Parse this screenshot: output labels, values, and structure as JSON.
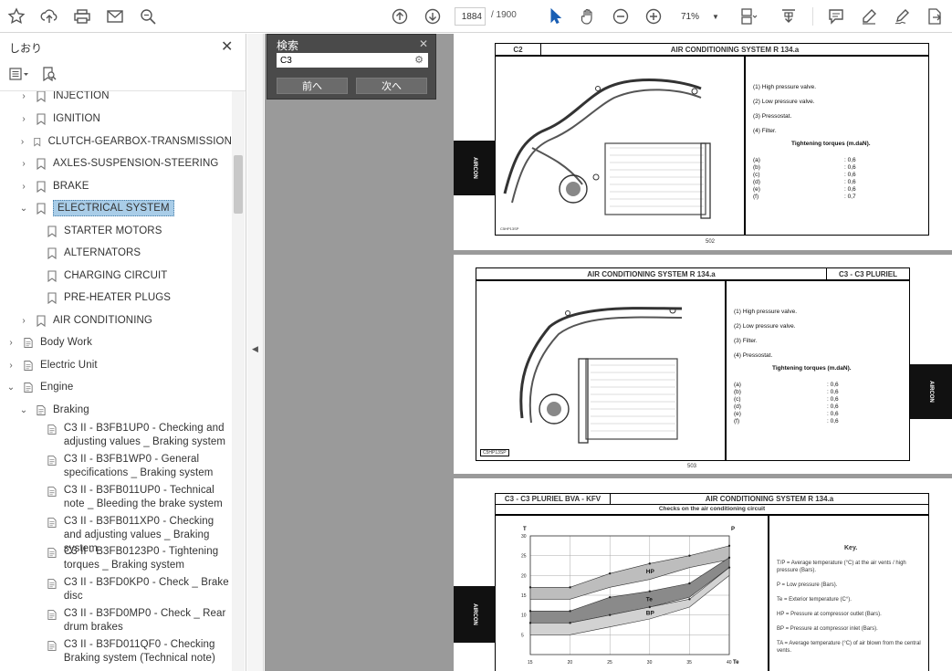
{
  "toolbar": {
    "page_current": "1884",
    "page_total": "/ 1900",
    "zoom": "71%"
  },
  "sidebar": {
    "title": "しおり",
    "items": [
      {
        "label": "INJECTION",
        "level": 1,
        "expanded": false,
        "type": "bookmark"
      },
      {
        "label": "IGNITION",
        "level": 1,
        "expanded": false,
        "type": "bookmark"
      },
      {
        "label": "CLUTCH-GEARBOX-TRANSMISSION",
        "level": 1,
        "expanded": false,
        "type": "bookmark"
      },
      {
        "label": "AXLES-SUSPENSION-STEERING",
        "level": 1,
        "expanded": false,
        "type": "bookmark"
      },
      {
        "label": "BRAKE",
        "level": 1,
        "expanded": false,
        "type": "bookmark"
      },
      {
        "label": "ELECTRICAL SYSTEM",
        "level": 1,
        "expanded": true,
        "type": "bookmark",
        "selected": true
      },
      {
        "label": "STARTER MOTORS",
        "level": 2,
        "type": "bookmark"
      },
      {
        "label": "ALTERNATORS",
        "level": 2,
        "type": "bookmark"
      },
      {
        "label": "CHARGING CIRCUIT",
        "level": 2,
        "type": "bookmark"
      },
      {
        "label": "PRE-HEATER PLUGS",
        "level": 2,
        "type": "bookmark"
      },
      {
        "label": "AIR CONDITIONING",
        "level": 1,
        "expanded": false,
        "type": "bookmark"
      },
      {
        "label": "Body Work",
        "level": 0,
        "expanded": false,
        "type": "doc"
      },
      {
        "label": "Electric Unit",
        "level": 0,
        "expanded": false,
        "type": "doc"
      },
      {
        "label": "Engine",
        "level": 0,
        "expanded": true,
        "type": "doc"
      },
      {
        "label": "Braking",
        "level": 1,
        "expanded": true,
        "type": "doc"
      },
      {
        "label": "C3 II - B3FB1UP0 - Checking and adjusting values _ Braking system",
        "level": 2,
        "type": "page"
      },
      {
        "label": "C3 II - B3FB1WP0 - General specifications _ Braking system",
        "level": 2,
        "type": "page"
      },
      {
        "label": "C3 II - B3FB011UP0 - Technical note _ Bleeding the brake system",
        "level": 2,
        "type": "page"
      },
      {
        "label": "C3 II - B3FB011XP0 - Checking and adjusting values _ Braking system",
        "level": 2,
        "type": "page"
      },
      {
        "label": "C3 II - B3FB0123P0 - Tightening torques _ Braking system",
        "level": 2,
        "type": "page"
      },
      {
        "label": "C3 II - B3FD0KP0 - Check _ Brake disc",
        "level": 2,
        "type": "page"
      },
      {
        "label": "C3 II - B3FD0MP0 - Check _ Rear drum brakes",
        "level": 2,
        "type": "page"
      },
      {
        "label": "C3 II - B3FD011QF0 - Checking Braking system (Technical note)",
        "level": 2,
        "type": "page"
      }
    ]
  },
  "find": {
    "title": "検索",
    "query": "C3",
    "prev_label": "前へ",
    "next_label": "次へ"
  },
  "pages": {
    "p1": {
      "model": "C2",
      "title": "AIR CONDITIONING SYSTEM R 134.a",
      "tab": "AIRCON",
      "legend": [
        "(1) High pressure valve.",
        "(2) Low pressure valve.",
        "(3) Pressostat.",
        "(4) Filter."
      ],
      "torque_title": "Tightening torques (m.daN).",
      "torques": [
        [
          "(a)",
          ": 0,6"
        ],
        [
          "(b)",
          ": 0,6"
        ],
        [
          "(c)",
          ": 0,6"
        ],
        [
          "(d)",
          ": 0,6"
        ],
        [
          "(e)",
          ": 0,6"
        ],
        [
          "(f)",
          ": 0,7"
        ]
      ],
      "page_no": "502"
    },
    "p2": {
      "model": "C3 - C3 PLURIEL",
      "title": "AIR CONDITIONING SYSTEM R 134.a",
      "tab": "AIRCON",
      "legend": [
        "(1) High pressure valve.",
        "(2) Low pressure valve.",
        "(3) Filter.",
        "(4) Pressostat."
      ],
      "torque_title": "Tightening torques (m.daN).",
      "torques": [
        [
          "(a)",
          ": 0,6"
        ],
        [
          "(b)",
          ": 0,6"
        ],
        [
          "(c)",
          ": 0,6"
        ],
        [
          "(d)",
          ": 0,6"
        ],
        [
          "(e)",
          ": 0,6"
        ],
        [
          "(f)",
          ": 0,6"
        ]
      ],
      "fig_code": "C5HP13SP",
      "page_no": "503"
    },
    "p3": {
      "model": "C3 - C3 PLURIEL BVA - KFV",
      "title": "AIR CONDITIONING SYSTEM R 134.a",
      "subtitle": "Checks on the air conditioning circuit",
      "tab": "AIRCON",
      "key_title": "Key.",
      "key": [
        "T/P = Average temperature (°C) at the air vents / high pressure (Bars).",
        "P = Low pressure (Bars).",
        "Te = Exterior temperature (C°).",
        "HP = Pressure at compressor outlet (Bars).",
        "BP = Pressure at compressor inlet (Bars).",
        "TA = Average temperature (°C) of air blown from the central vents."
      ]
    }
  },
  "chart_data": {
    "type": "area",
    "title": "Checks on the air conditioning circuit",
    "xlabel": "Te",
    "ylabel_left": "T",
    "ylabel_right": "P",
    "x_ticks": [
      "15",
      "20",
      "25",
      "30",
      "35",
      "40"
    ],
    "y_ticks": [
      "5",
      "10",
      "15",
      "20",
      "25",
      "30"
    ],
    "xlim": [
      15,
      40
    ],
    "ylim": [
      0,
      30
    ],
    "series": [
      {
        "name": "HP",
        "upper": [
          17,
          17,
          20.5,
          23,
          25,
          27.5
        ],
        "lower": [
          14,
          14,
          17,
          19,
          22,
          24
        ]
      },
      {
        "name": "Te",
        "upper": [
          11,
          11,
          14.5,
          16,
          18,
          24.5
        ],
        "lower": [
          8,
          8,
          10,
          12,
          14.5,
          22
        ]
      },
      {
        "name": "BP",
        "upper": [
          8,
          8,
          10,
          12,
          14,
          22
        ],
        "lower": [
          5,
          5,
          7,
          9,
          12,
          20
        ]
      }
    ],
    "grid": true
  }
}
